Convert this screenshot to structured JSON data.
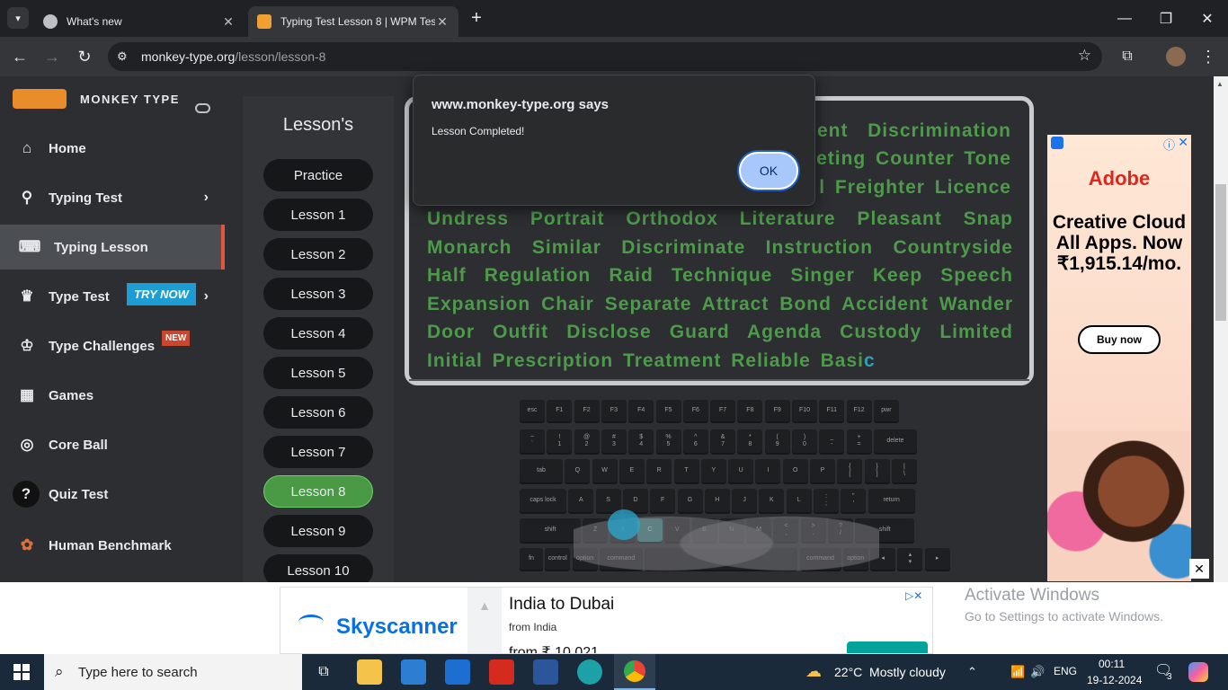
{
  "browser": {
    "tabs": [
      {
        "title": "What's new",
        "active": false
      },
      {
        "title": "Typing Test Lesson 8 | WPM Tes",
        "active": true
      }
    ],
    "url_host": "monkey-type.org",
    "url_path": "/lesson/lesson-8"
  },
  "site": {
    "brand": "MONKEY TYPE",
    "nav": [
      {
        "label": "Home",
        "icon": "home-icon"
      },
      {
        "label": "Typing Test",
        "icon": "keyboard-hand-icon",
        "chevron": true
      },
      {
        "label": "Typing Lesson",
        "icon": "keyboard-icon",
        "active": true
      },
      {
        "label": "Type Test",
        "icon": "crown-icon",
        "chevron": true,
        "badge": "TRY NOW"
      },
      {
        "label": "Type Challenges",
        "icon": "trophy-icon",
        "badge": "NEW"
      },
      {
        "label": "Games",
        "icon": "grid-icon"
      },
      {
        "label": "Core Ball",
        "icon": "target-icon"
      },
      {
        "label": "Quiz Test",
        "icon": "quiz-icon"
      },
      {
        "label": "Human Benchmark",
        "icon": "brain-icon"
      }
    ]
  },
  "lessons": {
    "heading": "Lesson's",
    "items": [
      "Practice",
      "Lesson 1",
      "Lesson 2",
      "Lesson 3",
      "Lesson 4",
      "Lesson 5",
      "Lesson 6",
      "Lesson 7",
      "Lesson 8",
      "Lesson 9",
      "Lesson 10"
    ],
    "active_index": 8
  },
  "typing": {
    "line1_fragment": "ent  Discrimination",
    "line2_fragment": "eting Counter Tone",
    "line3_fragment": "l Freighter Licence",
    "body": "Undress Portrait Orthodox Literature Pleasant Snap Monarch Similar Discriminate Instruction Countryside Half Regulation Raid Technique Singer Keep Speech Expansion Chair Separate Attract Bond Accident Wander Door Outfit Disclose Guard Agenda Custody Limited Initial Prescription Treatment Reliable Basi",
    "cursor_char": "c"
  },
  "dialog": {
    "site": "www.monkey-type.org says",
    "message": "Lesson Completed!",
    "ok_label": "OK"
  },
  "ad_right": {
    "brand": "Adobe",
    "headline": "Creative Cloud All Apps. Now ₹1,915.14/mo.",
    "cta": "Buy now"
  },
  "ad_bottom": {
    "brand": "Skyscanner",
    "title": "India to Dubai",
    "subtitle": "from India",
    "price_partial": "from ₹ 10,021"
  },
  "watermark": {
    "line1": "Activate Windows",
    "line2": "Go to Settings to activate Windows."
  },
  "taskbar": {
    "search_placeholder": "Type here to search",
    "weather": "22°C  Mostly cloudy",
    "lang": "ENG",
    "time": "00:11",
    "date": "19-12-2024",
    "notification_count": "3"
  }
}
